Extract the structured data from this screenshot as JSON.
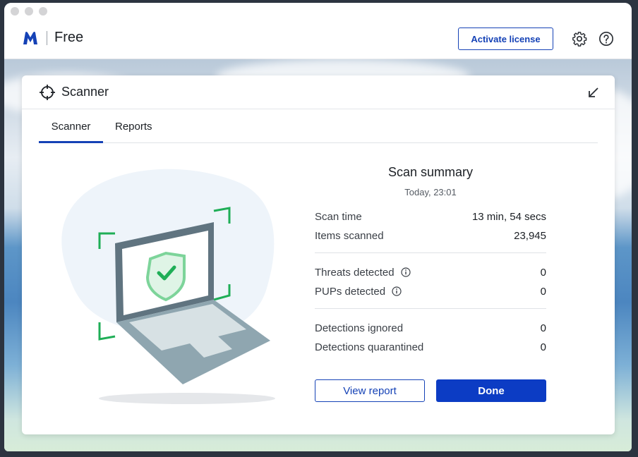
{
  "app": {
    "edition": "Free",
    "activate_label": "Activate license"
  },
  "panel": {
    "title": "Scanner"
  },
  "tabs": [
    {
      "label": "Scanner",
      "active": true
    },
    {
      "label": "Reports",
      "active": false
    }
  ],
  "summary": {
    "title": "Scan summary",
    "date": "Today, 23:01",
    "rows": [
      {
        "label": "Scan time",
        "value": "13 min, 54 secs"
      },
      {
        "label": "Items scanned",
        "value": "23,945"
      },
      {
        "label": "Threats detected",
        "value": "0"
      },
      {
        "label": "PUPs detected",
        "value": "0"
      },
      {
        "label": "Detections ignored",
        "value": "0"
      },
      {
        "label": "Detections quarantined",
        "value": "0"
      }
    ]
  },
  "buttons": {
    "view_report": "View report",
    "done": "Done"
  },
  "colors": {
    "accent": "#1542b6",
    "primary": "#0c3cc4",
    "success": "#2bbd5a"
  },
  "icons": [
    "malwarebytes-logo-icon",
    "gear-icon",
    "help-icon",
    "crosshair-icon",
    "minimize-arrow-icon",
    "info-icon",
    "laptop-shield-illustration"
  ]
}
